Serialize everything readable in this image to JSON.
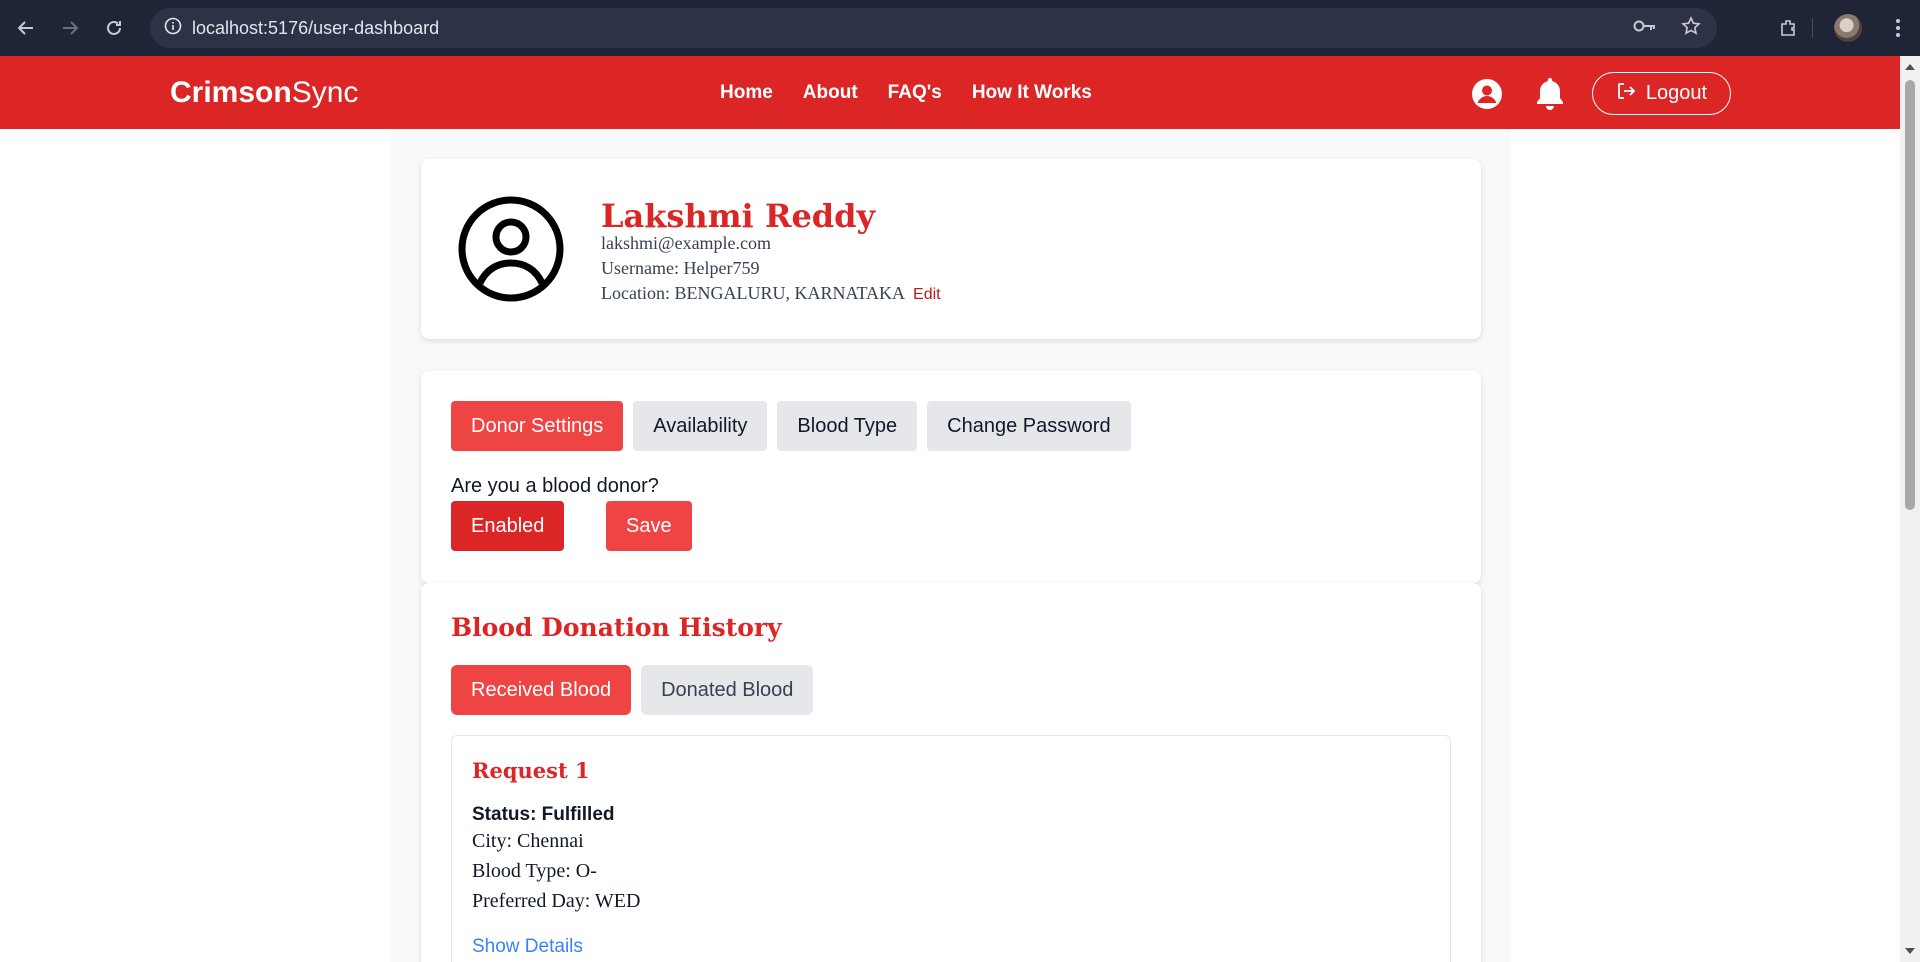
{
  "browser": {
    "url": "localhost:5176/user-dashboard",
    "icons": [
      "back-icon",
      "forward-icon",
      "reload-icon",
      "site-info-icon",
      "key-icon",
      "star-icon",
      "extensions-icon",
      "profile-avatar",
      "kebab-menu-icon"
    ]
  },
  "nav": {
    "brand_bold": "Crimson",
    "brand_light": "Sync",
    "links": [
      "Home",
      "About",
      "FAQ's",
      "How It Works"
    ],
    "logout": "Logout"
  },
  "profile": {
    "name": "Lakshmi Reddy",
    "email": "lakshmi@example.com",
    "username": "Username: Helper759",
    "location": "Location: BENGALURU, KARNATAKA",
    "edit": "Edit"
  },
  "settings": {
    "tabs": [
      "Donor Settings",
      "Availability",
      "Blood Type",
      "Change Password"
    ],
    "active_tab": "Donor Settings",
    "question": "Are you a blood donor?",
    "enabled": "Enabled",
    "save": "Save"
  },
  "history": {
    "title": "Blood Donation History",
    "tabs": [
      "Received Blood",
      "Donated Blood"
    ],
    "active_tab": "Received Blood",
    "requests": [
      {
        "title": "Request 1",
        "status": "Status: Fulfilled",
        "city": "City: Chennai",
        "blood_type": "Blood Type: O-",
        "preferred_day": "Preferred Day: WED",
        "show_details": "Show Details"
      }
    ]
  },
  "colors": {
    "brand_red": "#dc2626",
    "accent_red": "#ef4444",
    "link_blue": "#3b82f6"
  }
}
